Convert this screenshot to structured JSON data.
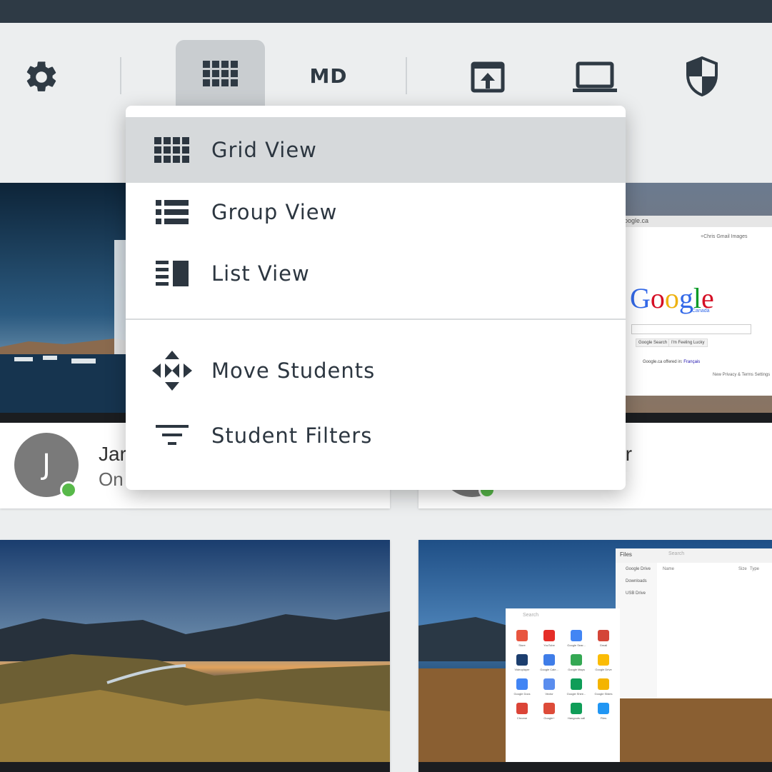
{
  "toolbar": {
    "settings_icon": "gear-icon",
    "grid_icon": "grid-icon",
    "class_code": "MD",
    "share_icon": "share-screen-icon",
    "screen_icon": "laptop-icon",
    "security_icon": "shield-icon"
  },
  "view_menu": {
    "items": [
      {
        "label": "Grid View",
        "icon": "grid-icon",
        "selected": true
      },
      {
        "label": "Group View",
        "icon": "list-bullets-icon"
      },
      {
        "label": "List View",
        "icon": "list-detail-icon"
      },
      {
        "label": "Move Students",
        "icon": "move-arrows-icon"
      },
      {
        "label": "Student Filters",
        "icon": "filter-icon"
      }
    ]
  },
  "students": [
    {
      "initial": "J",
      "name_partial": "Jar",
      "status_partial": "On"
    },
    {
      "name_partial": "ler"
    }
  ],
  "browser_thumbnail": {
    "logo": "Google",
    "logo_sub": "Canada",
    "url_partial": "oogle.ca",
    "topbar_links": "+Chris  Gmail  Images",
    "button_search": "Google Search",
    "button_lucky": "I'm Feeling Lucky",
    "offered_in": "Google.ca offered in:",
    "offered_lang": "Français",
    "footer_links": "New Privacy & Terms   Settings"
  },
  "files_thumbnail": {
    "title": "Files",
    "search_placeholder": "Search",
    "sidebar": [
      "Google Drive",
      "Downloads",
      "USB Drive"
    ],
    "columns": [
      "Name",
      "Size",
      "Type"
    ],
    "launcher_search": "Search",
    "apps": [
      "Store",
      "YouTube",
      "Google Sear...",
      "Gmail",
      "Videoplayer",
      "Google Cale...",
      "Google Maps",
      "Google Drive",
      "Google Docs",
      "Vector",
      "Google Shee...",
      "Google Slides",
      "Chrome",
      "Google+",
      "Hangouts call",
      "Files"
    ]
  },
  "colors": {
    "topbar": "#2e3a45",
    "toolbar_icon": "#2f3a44",
    "active_bg": "#c9cdd0",
    "presence_online": "#58b94a"
  }
}
